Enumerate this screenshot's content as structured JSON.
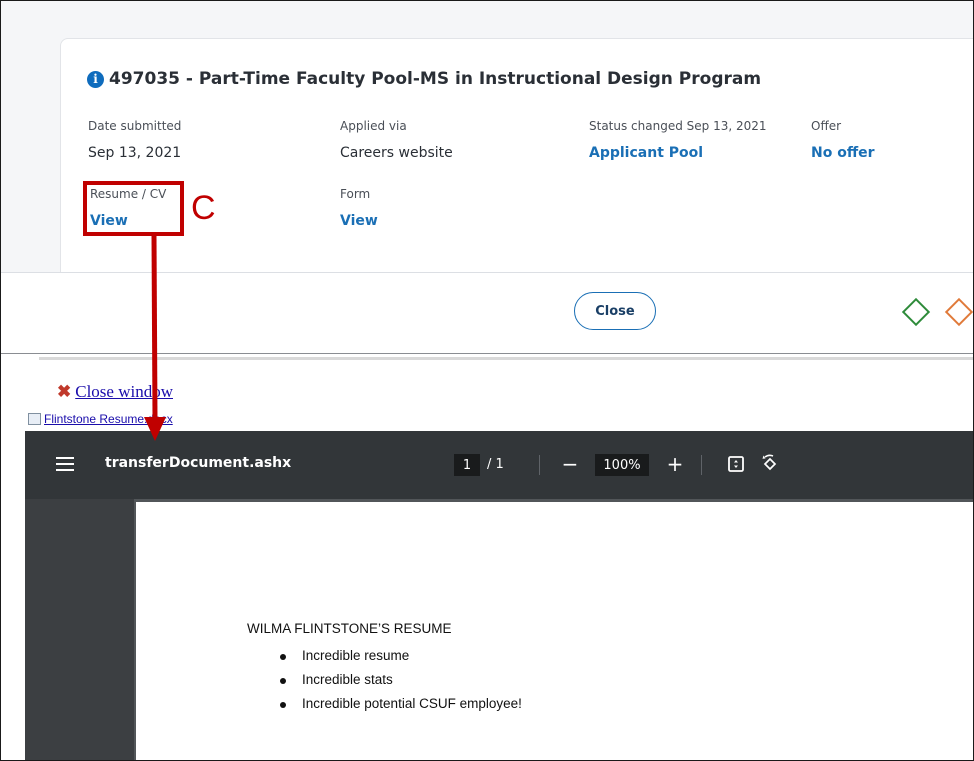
{
  "application": {
    "title": "497035 - Part-Time Faculty Pool-MS in Instructional Design Program",
    "fields": {
      "date_submitted": {
        "label": "Date submitted",
        "value": "Sep 13, 2021"
      },
      "applied_via": {
        "label": "Applied via",
        "value": "Careers website"
      },
      "status": {
        "label": "Status changed Sep 13, 2021",
        "value": "Applicant Pool"
      },
      "offer": {
        "label": "Offer",
        "value": "No offer"
      },
      "resume": {
        "label": "Resume / CV",
        "value": "View"
      },
      "form": {
        "label": "Form",
        "value": "View"
      }
    },
    "close_label": "Close"
  },
  "annotation": {
    "letter": "C",
    "color": "#c00000"
  },
  "legacy": {
    "close_window": "Close window",
    "file_name": "Flintstone Resume.docx"
  },
  "pdf_viewer": {
    "title": "transferDocument.ashx",
    "current_page": "1",
    "page_total": "/ 1",
    "zoom": "100%",
    "minus": "−",
    "plus": "+"
  },
  "document": {
    "heading": "WILMA FLINTSTONE’S RESUME",
    "bullets": [
      "Incredible resume",
      "Incredible stats",
      "Incredible potential CSUF employee!"
    ]
  },
  "colors": {
    "link": "#1a6fb5",
    "accent_red": "#c00000",
    "toolbar": "#323639"
  },
  "icons": [
    "info-icon",
    "menu-icon",
    "fit-page-icon",
    "rotate-icon",
    "close-x-icon",
    "file-icon",
    "diamond-icon"
  ]
}
